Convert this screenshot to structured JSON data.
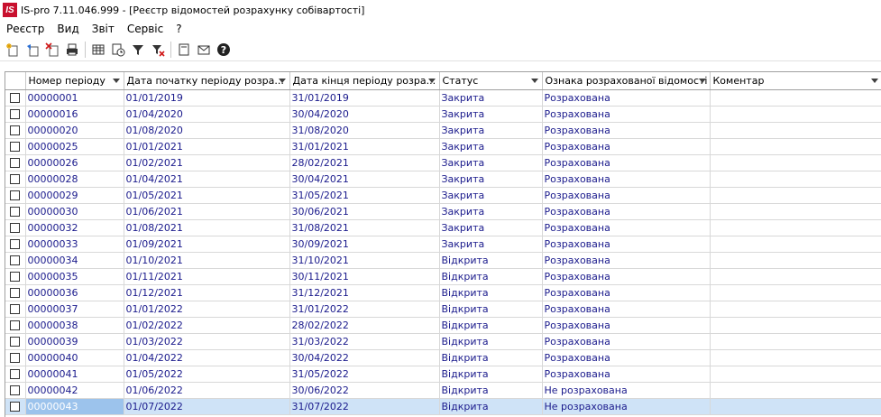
{
  "window": {
    "title": "IS-pro 7.11.046.999 - [Реєстр відомостей розрахунку собівартості]",
    "logo": "IS"
  },
  "menu": [
    "Реєстр",
    "Вид",
    "Звіт",
    "Сервіс",
    "?"
  ],
  "toolbar": [
    "new-document-icon",
    "copy-document-icon",
    "delete-document-icon",
    "print-icon",
    "table-icon",
    "history-icon",
    "filter-icon",
    "clear-filter-icon",
    "document-icon",
    "email-icon",
    "help-icon"
  ],
  "columns": [
    "Номер періоду",
    "Дата початку періоду розра...",
    "Дата кінця періоду розра...",
    "Статус",
    "Ознака розрахованої відомості",
    "Коментар"
  ],
  "rows": [
    [
      "00000001",
      "01/01/2019",
      "31/01/2019",
      "Закрита",
      "Розрахована",
      ""
    ],
    [
      "00000016",
      "01/04/2020",
      "30/04/2020",
      "Закрита",
      "Розрахована",
      ""
    ],
    [
      "00000020",
      "01/08/2020",
      "31/08/2020",
      "Закрита",
      "Розрахована",
      ""
    ],
    [
      "00000025",
      "01/01/2021",
      "31/01/2021",
      "Закрита",
      "Розрахована",
      ""
    ],
    [
      "00000026",
      "01/02/2021",
      "28/02/2021",
      "Закрита",
      "Розрахована",
      ""
    ],
    [
      "00000028",
      "01/04/2021",
      "30/04/2021",
      "Закрита",
      "Розрахована",
      ""
    ],
    [
      "00000029",
      "01/05/2021",
      "31/05/2021",
      "Закрита",
      "Розрахована",
      ""
    ],
    [
      "00000030",
      "01/06/2021",
      "30/06/2021",
      "Закрита",
      "Розрахована",
      ""
    ],
    [
      "00000032",
      "01/08/2021",
      "31/08/2021",
      "Закрита",
      "Розрахована",
      ""
    ],
    [
      "00000033",
      "01/09/2021",
      "30/09/2021",
      "Закрита",
      "Розрахована",
      ""
    ],
    [
      "00000034",
      "01/10/2021",
      "31/10/2021",
      "Відкрита",
      "Розрахована",
      ""
    ],
    [
      "00000035",
      "01/11/2021",
      "30/11/2021",
      "Відкрита",
      "Розрахована",
      ""
    ],
    [
      "00000036",
      "01/12/2021",
      "31/12/2021",
      "Відкрита",
      "Розрахована",
      ""
    ],
    [
      "00000037",
      "01/01/2022",
      "31/01/2022",
      "Відкрита",
      "Розрахована",
      ""
    ],
    [
      "00000038",
      "01/02/2022",
      "28/02/2022",
      "Відкрита",
      "Розрахована",
      ""
    ],
    [
      "00000039",
      "01/03/2022",
      "31/03/2022",
      "Відкрита",
      "Розрахована",
      ""
    ],
    [
      "00000040",
      "01/04/2022",
      "30/04/2022",
      "Відкрита",
      "Розрахована",
      ""
    ],
    [
      "00000041",
      "01/05/2022",
      "31/05/2022",
      "Відкрита",
      "Розрахована",
      ""
    ],
    [
      "00000042",
      "01/06/2022",
      "30/06/2022",
      "Відкрита",
      "Не розрахована",
      ""
    ],
    [
      "00000043",
      "01/07/2022",
      "31/07/2022",
      "Відкрита",
      "Не розрахована",
      ""
    ]
  ],
  "selected_row": 19,
  "colors": {
    "text": "#1a1a8c",
    "selection": "#cfe3f7",
    "selection_cell": "#9cc3ec",
    "logo": "#c8102e"
  }
}
